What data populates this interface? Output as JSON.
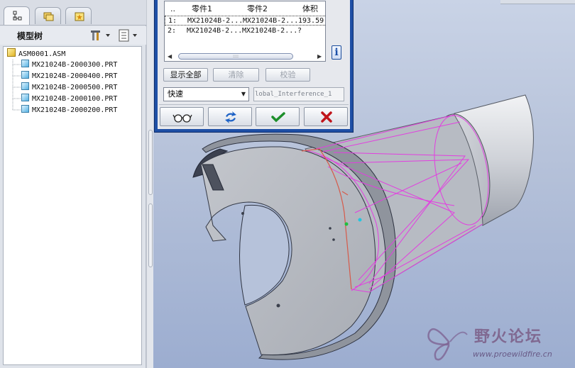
{
  "left_panel": {
    "tabs": [
      {
        "name": "model-tree-tab",
        "icon": "model-tree-icon"
      },
      {
        "name": "folder-browser-tab",
        "icon": "folder-icon"
      },
      {
        "name": "favorites-tab",
        "icon": "favorites-icon"
      }
    ],
    "tree_title": "模型树",
    "tree_tools_icon": "settings-tools-icon",
    "tree_view_icon": "show-list-icon",
    "root": "ASM0001.ASM",
    "items": [
      "MX21024B-2000300.PRT",
      "MX21024B-2000400.PRT",
      "MX21024B-2000500.PRT",
      "MX21024B-2000100.PRT",
      "MX21024B-2000200.PRT"
    ]
  },
  "dialog": {
    "columns": {
      "idx": "..",
      "part1": "零件1",
      "part2": "零件2",
      "volume": "体积"
    },
    "rows": [
      {
        "idx": "1:",
        "part1": "MX21024B-2...",
        "part2": "MX21024B-2...",
        "volume": "193.59"
      },
      {
        "idx": "2:",
        "part1": "MX21024B-2...",
        "part2": "MX21024B-2...",
        "volume": "?"
      }
    ],
    "scroll_grip": "::::",
    "info_label": "i",
    "show_all_label": "显示全部",
    "clear_label": "清除",
    "check_label": "校验",
    "mode_value": "快速",
    "name_value": "lobal_Interference_1",
    "commands": [
      {
        "name": "view-glasses-button",
        "icon": "glasses-icon"
      },
      {
        "name": "recompute-button",
        "icon": "refresh-icon"
      },
      {
        "name": "ok-button",
        "icon": "checkmark-icon"
      },
      {
        "name": "cancel-button",
        "icon": "close-x-icon"
      }
    ]
  },
  "watermark": {
    "title": "野火论坛",
    "url": "www.proewildfire.cn"
  },
  "colors": {
    "dialog_frame": "#1e4fa6",
    "highlight_magenta": "#e23ee0",
    "ok_green": "#1c8e2a",
    "cancel_red": "#c0151b",
    "part_gray": "#b9bcc4"
  }
}
